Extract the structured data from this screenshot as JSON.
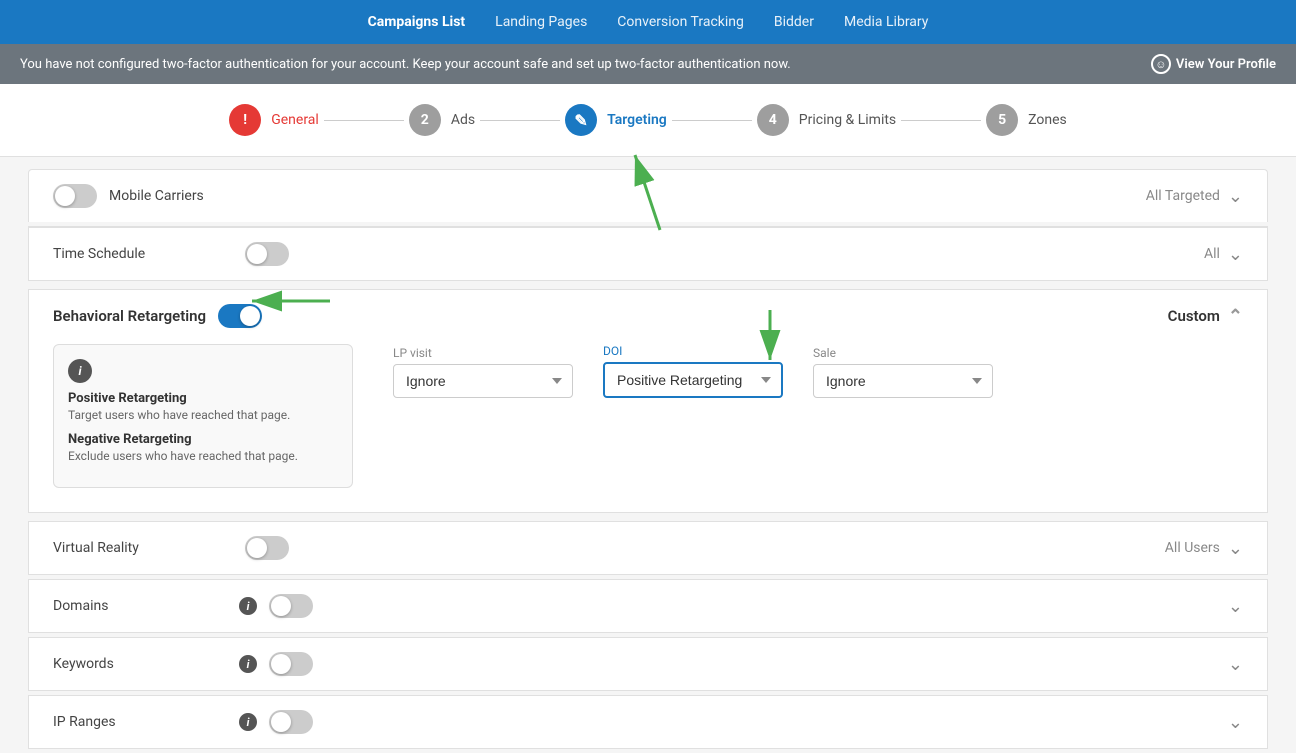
{
  "nav": {
    "items": [
      {
        "label": "Campaigns List",
        "active": true
      },
      {
        "label": "Landing Pages",
        "active": false
      },
      {
        "label": "Conversion Tracking",
        "active": false
      },
      {
        "label": "Bidder",
        "active": false
      },
      {
        "label": "Media Library",
        "active": false
      }
    ]
  },
  "alert": {
    "message": "You have not configured two-factor authentication for your account. Keep your account safe and set up two-factor authentication now.",
    "link_label": "View Your Profile"
  },
  "stepper": {
    "steps": [
      {
        "number": "!",
        "label": "General",
        "state": "error"
      },
      {
        "number": "2",
        "label": "Ads",
        "state": "inactive"
      },
      {
        "number": "✎",
        "label": "Targeting",
        "state": "active"
      },
      {
        "number": "4",
        "label": "Pricing & Limits",
        "state": "inactive"
      },
      {
        "number": "5",
        "label": "Zones",
        "state": "inactive"
      }
    ]
  },
  "sections": {
    "mobile_carriers": {
      "label": "Mobile Carriers",
      "value": "All Targeted"
    },
    "time_schedule": {
      "label": "Time Schedule",
      "value": "All"
    },
    "behavioral_retargeting": {
      "label": "Behavioral Retargeting",
      "value": "Custom",
      "tooltip": {
        "title_positive": "Positive Retargeting",
        "desc_positive": "Target users who have reached that page.",
        "title_negative": "Negative Retargeting",
        "desc_negative": "Exclude users who have reached that page."
      },
      "lp_visit": {
        "label": "LP visit",
        "options": [
          "Ignore",
          "Positive Retargeting",
          "Negative Retargeting"
        ],
        "selected": "Ignore"
      },
      "doi": {
        "label": "DOI",
        "options": [
          "Ignore",
          "Positive Retargeting",
          "Negative Retargeting"
        ],
        "selected": "Positive Retargeting"
      },
      "sale": {
        "label": "Sale",
        "options": [
          "Ignore",
          "Positive Retargeting",
          "Negative Retargeting"
        ],
        "selected": "Ignore"
      }
    },
    "virtual_reality": {
      "label": "Virtual Reality",
      "value": "All Users"
    },
    "domains": {
      "label": "Domains"
    },
    "keywords": {
      "label": "Keywords"
    },
    "ip_ranges": {
      "label": "IP Ranges"
    }
  },
  "colors": {
    "primary": "#1a78c2",
    "error": "#e53935",
    "inactive": "#9e9e9e",
    "green_arrow": "#4caf50"
  }
}
